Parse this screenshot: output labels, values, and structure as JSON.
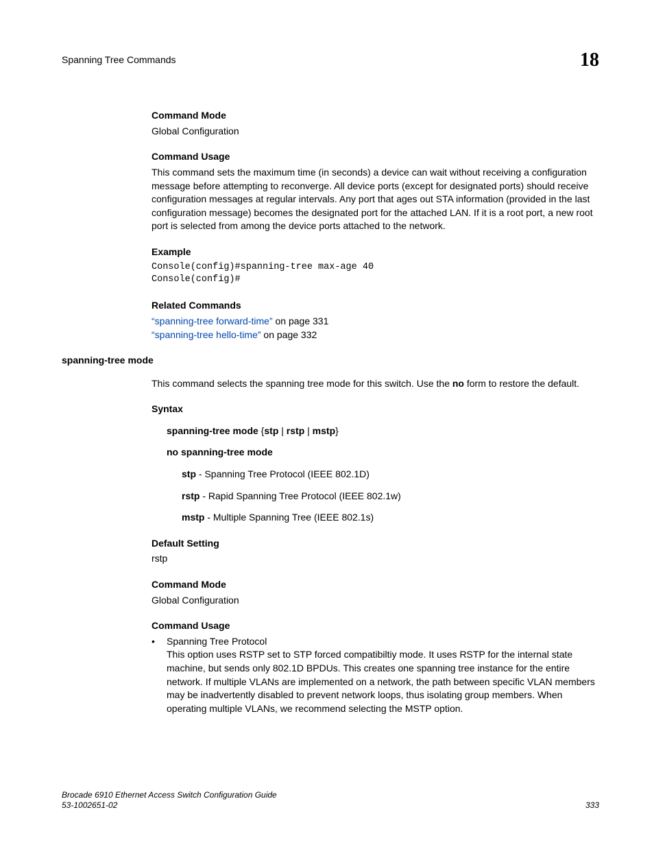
{
  "header": {
    "title": "Spanning Tree Commands",
    "chapter": "18"
  },
  "s1": {
    "head": "Command Mode",
    "body": "Global Configuration"
  },
  "s2": {
    "head": "Command Usage",
    "body": "This command sets the maximum time (in seconds) a device can wait without receiving a configuration message before attempting to reconverge. All device ports (except for designated ports) should receive configuration messages at regular intervals. Any port that ages out STA information (provided in the last configuration message) becomes the designated port for the attached LAN. If it is a root port, a new root port is selected from among the device ports attached to the network."
  },
  "s3": {
    "head": "Example",
    "code": "Console(config)#spanning-tree max-age 40\nConsole(config)#"
  },
  "s4": {
    "head": "Related Commands",
    "link1": "“spanning-tree forward-time”",
    "link1_suffix": " on page 331",
    "link2": "“spanning-tree hello-time”",
    "link2_suffix": " on page 332"
  },
  "cmd_name": "spanning-tree mode",
  "cmd_intro_pre": "This command selects the spanning tree mode for this switch. Use the ",
  "cmd_intro_bold": "no",
  "cmd_intro_post": " form to restore the default.",
  "syntax": {
    "head": "Syntax",
    "line1_pre": "spanning-tree mode",
    "line1_mid": " {",
    "line1_stp": "stp",
    "line1_p1": " | ",
    "line1_rstp": "rstp",
    "line1_p2": " | ",
    "line1_mstp": "mstp",
    "line1_post": "}",
    "line2": "no spanning-tree mode",
    "opt1_b": "stp",
    "opt1_t": " - Spanning Tree Protocol (IEEE 802.1D)",
    "opt2_b": "rstp",
    "opt2_t": " - Rapid Spanning Tree Protocol (IEEE 802.1w)",
    "opt3_b": "mstp",
    "opt3_t": " - Multiple Spanning Tree (IEEE 802.1s)"
  },
  "ds": {
    "head": "Default Setting",
    "body": "rstp"
  },
  "cm": {
    "head": "Command Mode",
    "body": "Global Configuration"
  },
  "cu": {
    "head": "Command Usage",
    "bullet": "•",
    "item_title": "Spanning Tree Protocol",
    "item_body": "This option uses RSTP set to STP forced compatibiltiy mode. It uses RSTP for the internal state machine, but sends only 802.1D BPDUs. This creates one spanning tree instance for the entire network. If multiple VLANs are implemented on a network, the path between specific VLAN members may be inadvertently disabled to prevent network loops, thus isolating group members. When operating multiple VLANs, we recommend selecting the MSTP option."
  },
  "footer": {
    "line1": "Brocade 6910 Ethernet Access Switch Configuration Guide",
    "line2": "53-1002651-02",
    "page": "333"
  }
}
